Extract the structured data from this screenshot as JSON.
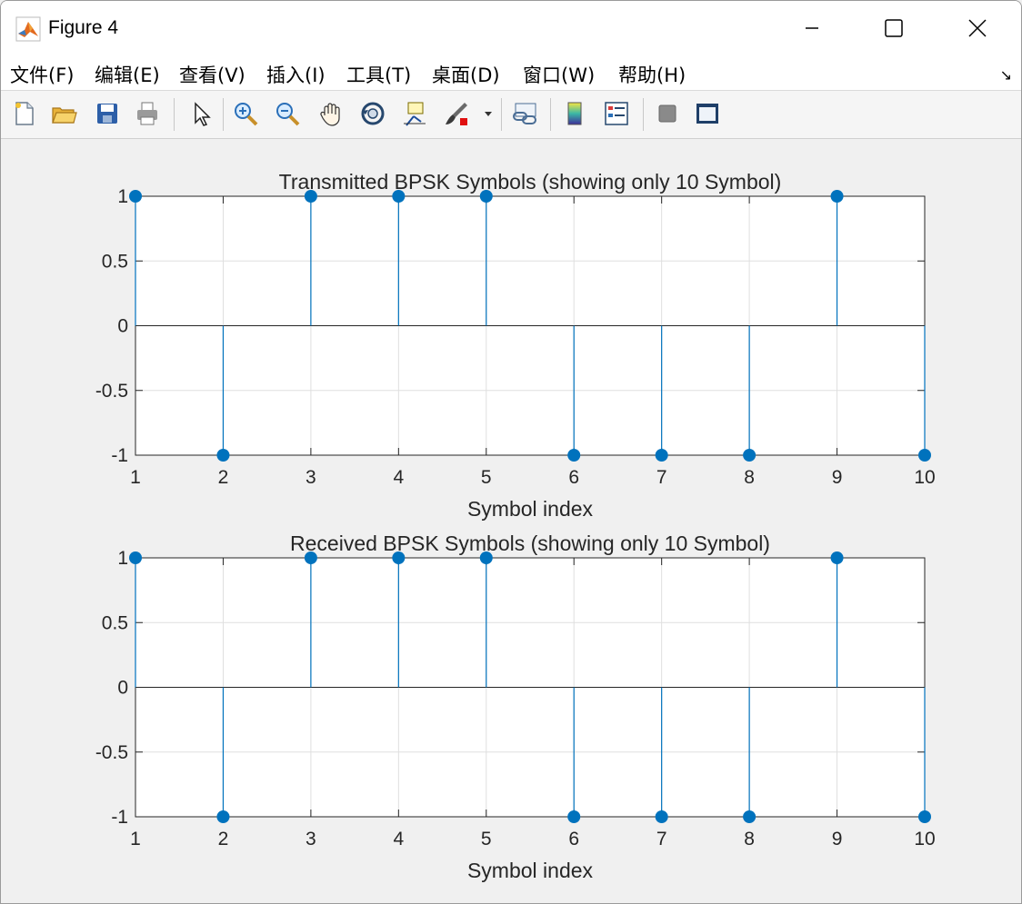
{
  "window": {
    "title": "Figure 4",
    "icons": {
      "app": "matlab-icon",
      "minimize": "minimize-icon",
      "maximize": "maximize-icon",
      "close": "close-icon"
    }
  },
  "menu": {
    "items": [
      {
        "label": "文件(F)",
        "key": "file"
      },
      {
        "label": "编辑(E)",
        "key": "edit"
      },
      {
        "label": "查看(V)",
        "key": "view"
      },
      {
        "label": "插入(I)",
        "key": "insert"
      },
      {
        "label": "工具(T)",
        "key": "tools"
      },
      {
        "label": "桌面(D)",
        "key": "desktop"
      },
      {
        "label": "窗口(W)",
        "key": "window"
      },
      {
        "label": "帮助(H)",
        "key": "help"
      }
    ],
    "dock_icon": "dock-arrow-icon"
  },
  "toolbar": {
    "buttons": [
      "new-figure-icon",
      "open-file-icon",
      "save-icon",
      "print-icon",
      "pointer-icon",
      "zoom-in-icon",
      "zoom-out-icon",
      "pan-icon",
      "rotate-3d-icon",
      "data-cursor-icon",
      "brush-icon",
      "link-plot-icon",
      "colorbar-icon",
      "legend-icon",
      "hide-plot-tools-icon",
      "show-plot-tools-icon"
    ]
  },
  "colors": {
    "stem": "#0072bd",
    "axis": "#262626",
    "grid": "#dfdfdf",
    "background": "#f0f0f0"
  },
  "chart_data": [
    {
      "type": "stem",
      "title": "Transmitted BPSK Symbols (showing only 10 Symbol)",
      "xlabel": "Symbol index",
      "ylabel": "",
      "x": [
        1,
        2,
        3,
        4,
        5,
        6,
        7,
        8,
        9,
        10
      ],
      "values": [
        1,
        -1,
        1,
        1,
        1,
        -1,
        -1,
        -1,
        1,
        -1
      ],
      "xlim": [
        1,
        10
      ],
      "ylim": [
        -1,
        1
      ],
      "xticks": [
        "1",
        "2",
        "3",
        "4",
        "5",
        "6",
        "7",
        "8",
        "9",
        "10"
      ],
      "yticks": [
        "-1",
        "-0.5",
        "0",
        "0.5",
        "1"
      ],
      "grid": true
    },
    {
      "type": "stem",
      "title": "Received BPSK Symbols (showing only 10 Symbol)",
      "xlabel": "Symbol index",
      "ylabel": "",
      "x": [
        1,
        2,
        3,
        4,
        5,
        6,
        7,
        8,
        9,
        10
      ],
      "values": [
        1,
        -1,
        1,
        1,
        1,
        -1,
        -1,
        -1,
        1,
        -1
      ],
      "xlim": [
        1,
        10
      ],
      "ylim": [
        -1,
        1
      ],
      "xticks": [
        "1",
        "2",
        "3",
        "4",
        "5",
        "6",
        "7",
        "8",
        "9",
        "10"
      ],
      "yticks": [
        "-1",
        "-0.5",
        "0",
        "0.5",
        "1"
      ],
      "grid": true
    }
  ]
}
